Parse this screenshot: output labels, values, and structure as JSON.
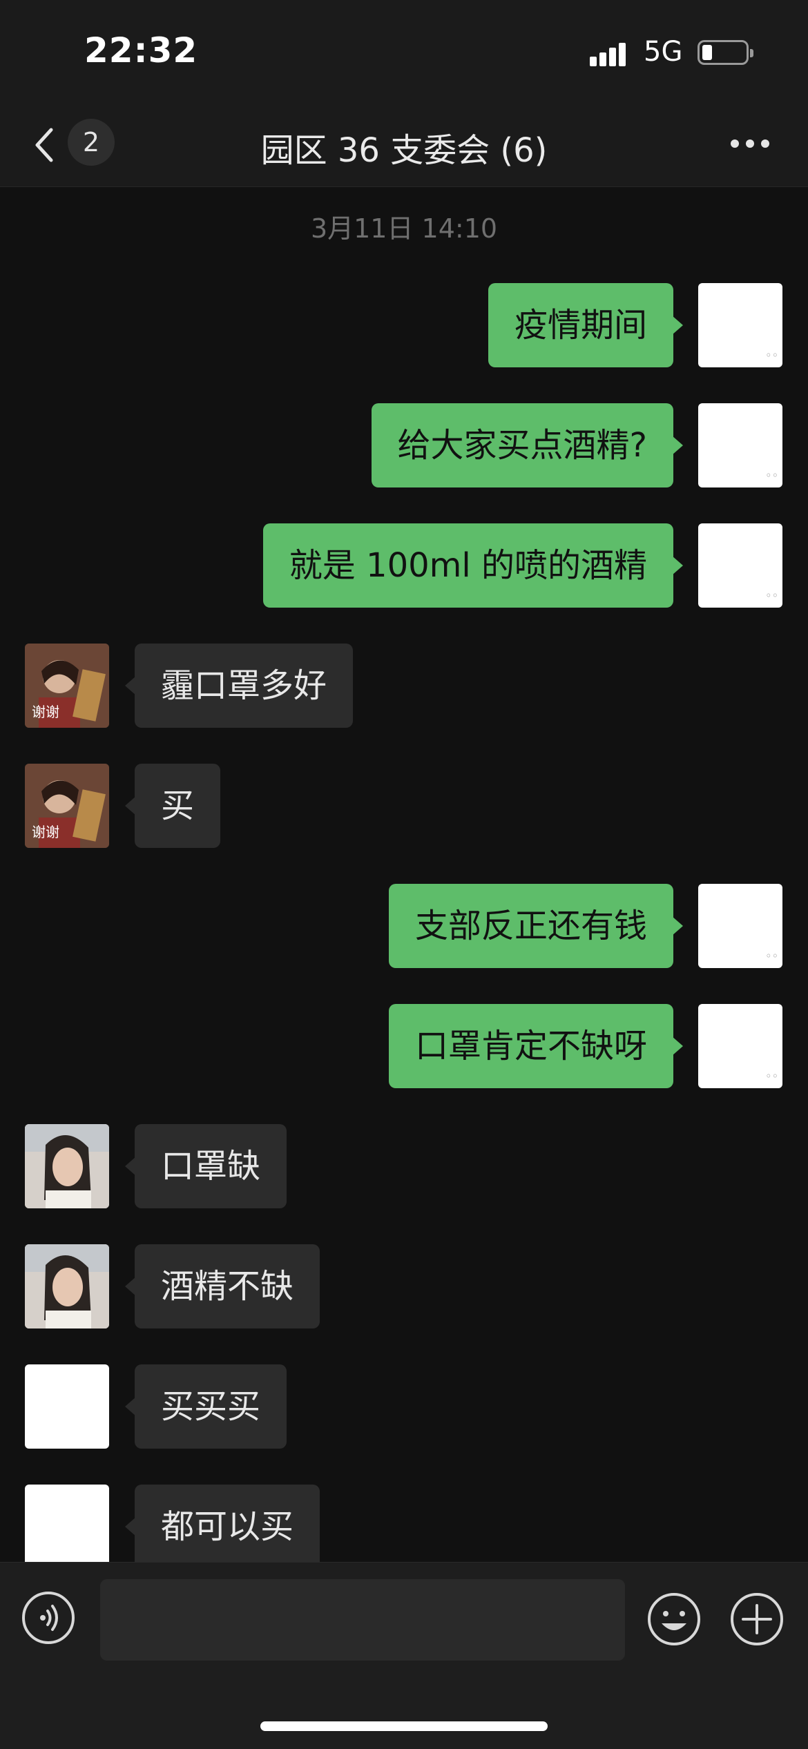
{
  "status": {
    "time": "22:32",
    "network": "5G"
  },
  "nav": {
    "badge": "2",
    "title": "园区 36 支委会 (6)"
  },
  "timestamp": "3月11日 14:10",
  "messages": [
    {
      "side": "out",
      "sender": "me",
      "text": "疫情期间"
    },
    {
      "side": "out",
      "sender": "me",
      "text": "给大家买点酒精?"
    },
    {
      "side": "out",
      "sender": "me",
      "text": "就是 100ml 的喷的酒精"
    },
    {
      "side": "in",
      "sender": "member-1",
      "avatar_caption": "谢谢",
      "text": "霾口罩多好"
    },
    {
      "side": "in",
      "sender": "member-1",
      "avatar_caption": "谢谢",
      "text": "买"
    },
    {
      "side": "out",
      "sender": "me",
      "text": "支部反正还有钱"
    },
    {
      "side": "out",
      "sender": "me",
      "text": "口罩肯定不缺呀"
    },
    {
      "side": "in",
      "sender": "member-2",
      "text": "口罩缺"
    },
    {
      "side": "in",
      "sender": "member-2",
      "text": "酒精不缺"
    },
    {
      "side": "in",
      "sender": "member-3",
      "text": "买买买"
    },
    {
      "side": "in",
      "sender": "member-3",
      "text": "都可以买"
    }
  ],
  "input": {
    "value": "",
    "placeholder": ""
  },
  "icons": {
    "back": "chevron-left-icon",
    "more": "more-icon",
    "voice": "voice-icon",
    "emoji": "emoji-icon",
    "add": "plus-icon"
  },
  "colors": {
    "background": "#111111",
    "outgoing_bubble": "#5ebd6a",
    "incoming_bubble": "#2c2c2c",
    "bar": "#1b1b1b"
  }
}
